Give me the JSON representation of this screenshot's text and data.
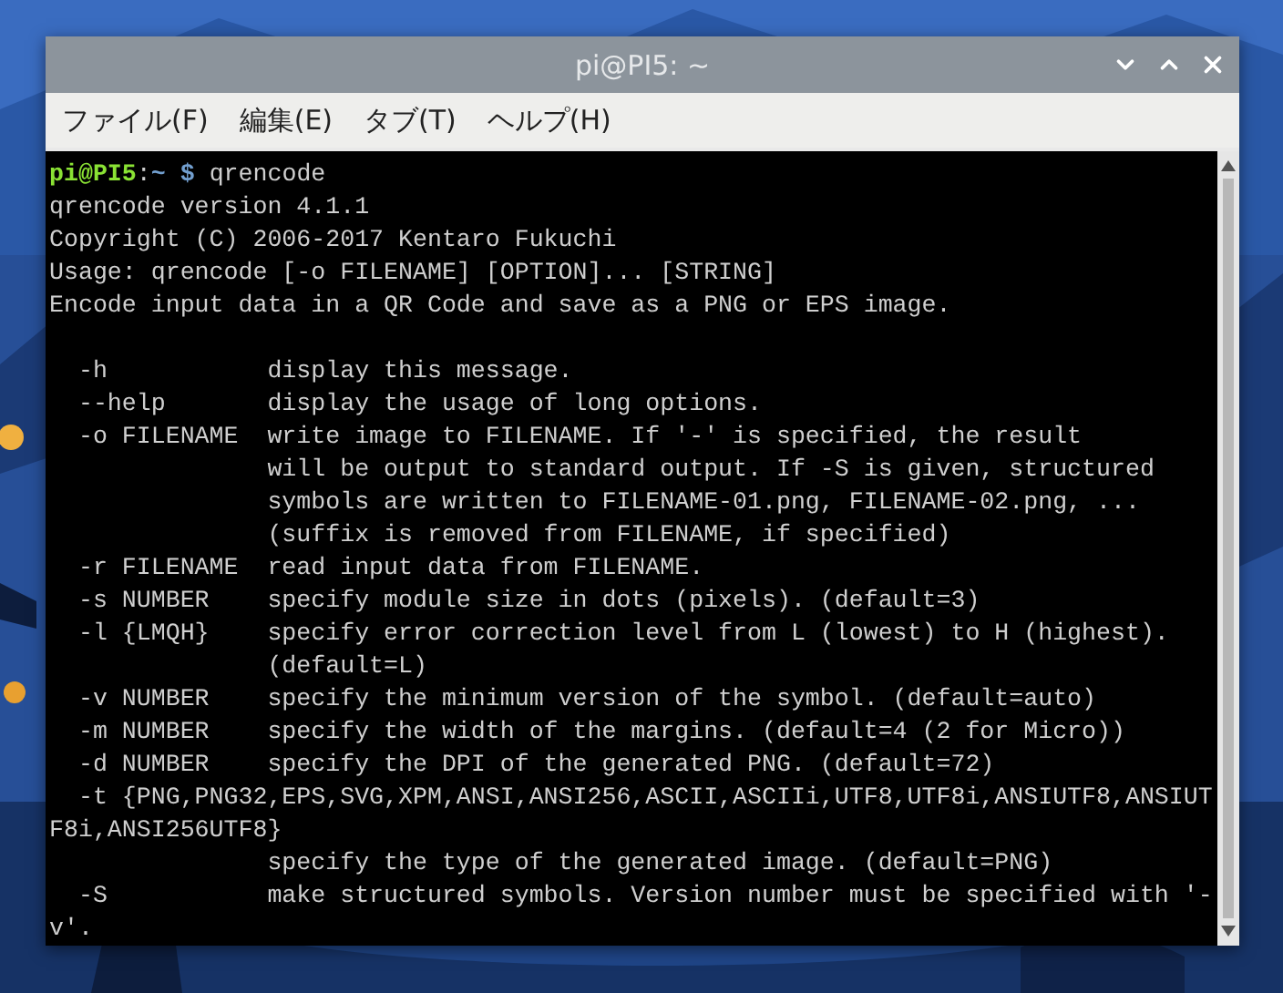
{
  "window": {
    "title": "pi@PI5: ~"
  },
  "menu": [
    {
      "label": "ファイル(F)"
    },
    {
      "label": "編集(E)"
    },
    {
      "label": "タブ(T)"
    },
    {
      "label": "ヘルプ(H)"
    }
  ],
  "terminal": {
    "prompt": {
      "user": "pi@PI5",
      "separator": ":",
      "path": "~",
      "symbol": "$",
      "command": "qrencode"
    },
    "blocks": [
      [
        "qrencode version 4.1.1",
        "Copyright (C) 2006-2017 Kentaro Fukuchi",
        "Usage: qrencode [-o FILENAME] [OPTION]... [STRING]",
        "Encode input data in a QR Code and save as a PNG or EPS image."
      ],
      [
        "  -h           display this message.",
        "  --help       display the usage of long options.",
        "  -o FILENAME  write image to FILENAME. If '-' is specified, the result",
        "               will be output to standard output. If -S is given, structured",
        "               symbols are written to FILENAME-01.png, FILENAME-02.png, ...",
        "               (suffix is removed from FILENAME, if specified)",
        "  -r FILENAME  read input data from FILENAME.",
        "  -s NUMBER    specify module size in dots (pixels). (default=3)",
        "  -l {LMQH}    specify error correction level from L (lowest) to H (highest).",
        "               (default=L)",
        "  -v NUMBER    specify the minimum version of the symbol. (default=auto)",
        "  -m NUMBER    specify the width of the margins. (default=4 (2 for Micro))",
        "  -d NUMBER    specify the DPI of the generated PNG. (default=72)",
        "  -t {PNG,PNG32,EPS,SVG,XPM,ANSI,ANSI256,ASCII,ASCIIi,UTF8,UTF8i,ANSIUTF8,ANSIUT",
        "F8i,ANSI256UTF8}",
        "               specify the type of the generated image. (default=PNG)",
        "  -S           make structured symbols. Version number must be specified with '-",
        "v'."
      ]
    ]
  }
}
